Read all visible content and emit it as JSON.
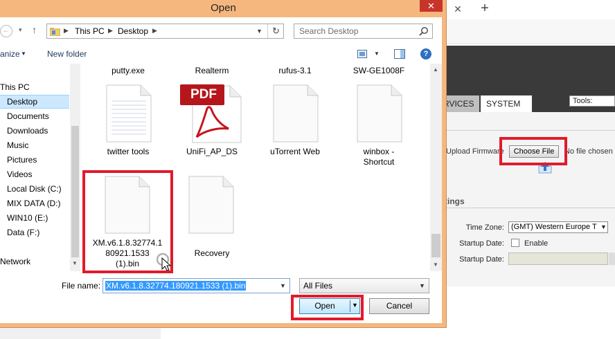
{
  "dialog": {
    "title": "Open",
    "close_glyph": "✕",
    "nav": {
      "back_glyph": "←",
      "forward_glyph": "▾",
      "up_glyph": "↑",
      "breadcrumb": [
        "This PC",
        "Desktop"
      ],
      "refresh_glyph": "↻",
      "search_placeholder": "Search Desktop"
    },
    "toolbar": {
      "organize_label": "anize",
      "new_folder_label": "New folder"
    },
    "sidebar": {
      "items": [
        {
          "label": "This PC",
          "selected": false
        },
        {
          "label": "Desktop",
          "selected": true
        },
        {
          "label": "Documents",
          "selected": false
        },
        {
          "label": "Downloads",
          "selected": false
        },
        {
          "label": "Music",
          "selected": false
        },
        {
          "label": "Pictures",
          "selected": false
        },
        {
          "label": "Videos",
          "selected": false
        },
        {
          "label": "Local Disk (C:)",
          "selected": false
        },
        {
          "label": "MIX DATA (D:)",
          "selected": false
        },
        {
          "label": "WIN10 (E:)",
          "selected": false
        },
        {
          "label": "Data (F:)",
          "selected": false
        },
        {
          "label": "Network",
          "selected": false
        }
      ]
    },
    "files": {
      "top_row_labels": [
        "putty.exe",
        "Realterm",
        "rufus-3.1",
        "SW-GE1008F"
      ],
      "items": [
        {
          "name": "twitter tools",
          "icon": "text-document-icon"
        },
        {
          "name": "UniFi_AP_DS",
          "icon": "pdf-icon",
          "icon_text": "PDF"
        },
        {
          "name": "uTorrent Web",
          "icon": "blank-document-icon"
        },
        {
          "name_line1": "winbox -",
          "name_line2": "Shortcut",
          "icon": "blank-document-icon"
        },
        {
          "name_line1": "XM.v6.1.8.32774.1",
          "name_line2": "80921.1533",
          "name_line3": "(1).bin",
          "icon": "blank-document-icon"
        },
        {
          "name": "Recovery",
          "icon": "blank-document-icon"
        }
      ]
    },
    "filename": {
      "label": "File name:",
      "value": "XM.v6.1.8.32774.180921.1533 (1).bin"
    },
    "filetype": {
      "value": "All Files"
    },
    "buttons": {
      "open": "Open",
      "cancel": "Cancel"
    }
  },
  "browser": {
    "new_tab_glyph": "+",
    "tab_close_glyph": "✕",
    "router": {
      "tabs": [
        "RVICES",
        "SYSTEM"
      ],
      "tools_label": "Tools:",
      "upload_label": "Upload Firmware",
      "choose_file": "Choose File",
      "no_file": "No file chosen",
      "settings_heading": "ttings",
      "timezone_label": "Time Zone:",
      "timezone_value": "(GMT) Western Europe T",
      "startup_date_label": "Startup Date:",
      "enable_label": "Enable",
      "startup_date_label2": "Startup Date:"
    }
  },
  "colors": {
    "dialog_frame": "#f6b77e",
    "close_button": "#c7352a",
    "selection": "#3399ff",
    "highlight_annotation": "#e01b2b",
    "router_header": "#3a3a3a"
  }
}
